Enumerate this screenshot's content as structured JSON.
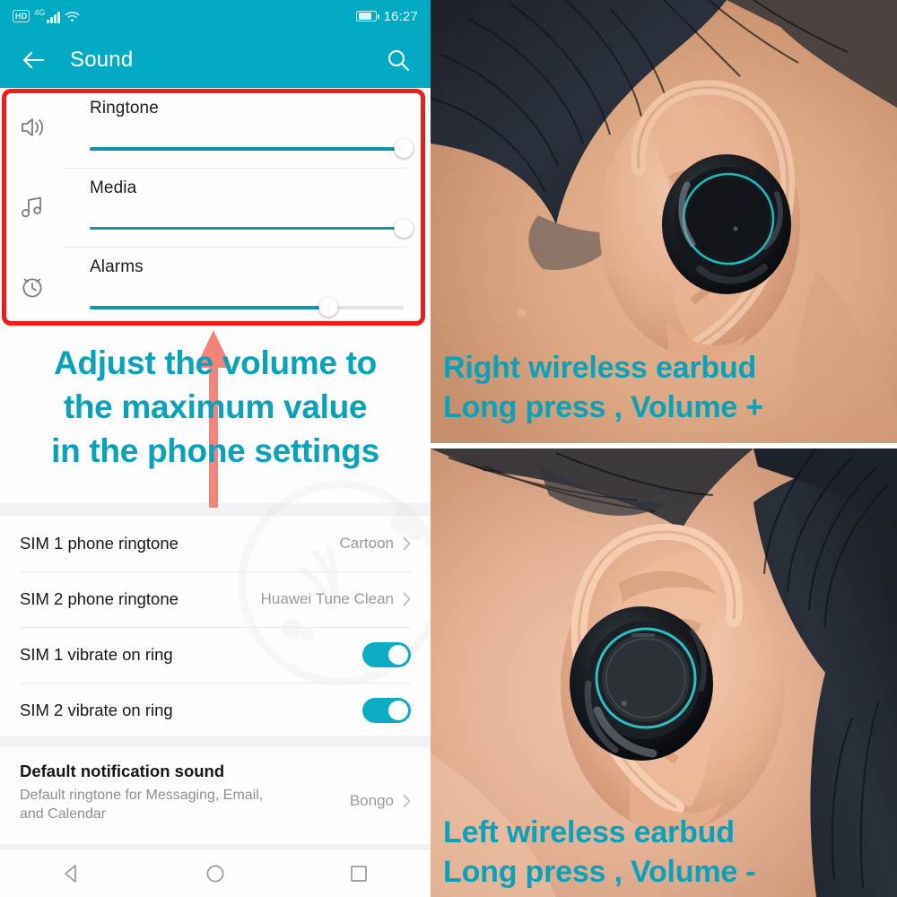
{
  "phone": {
    "statusbar": {
      "hd_badge": "HD",
      "network_label": "4G",
      "signal_icon": "signal-bars-icon",
      "wifi_icon": "wifi-icon",
      "battery_icon": "battery-icon",
      "clock": "16:27"
    },
    "actionbar": {
      "back_icon": "back-arrow-icon",
      "title": "Sound",
      "search_icon": "search-icon"
    },
    "volume_sliders": [
      {
        "icon": "speaker-volume-icon",
        "label": "Ringtone",
        "value": 100
      },
      {
        "icon": "music-note-icon",
        "label": "Media",
        "value": 100
      },
      {
        "icon": "alarm-clock-icon",
        "label": "Alarms",
        "value": 76
      }
    ],
    "caption": "Adjust the volume to the maximum value in the phone settings",
    "caption_lines": [
      "Adjust the volume to",
      "the maximum value",
      "in the phone settings"
    ],
    "arrow_icon": "up-arrow-annotation",
    "settings_rows": [
      {
        "label": "SIM 1 phone ringtone",
        "value": "Cartoon",
        "control": "chevron"
      },
      {
        "label": "SIM 2 phone ringtone",
        "value": "Huawei Tune Clean",
        "control": "chevron"
      },
      {
        "label": "SIM 1 vibrate on ring",
        "value": "",
        "control": "toggle",
        "toggle_on": true
      },
      {
        "label": "SIM 2 vibrate on ring",
        "value": "",
        "control": "toggle",
        "toggle_on": true
      }
    ],
    "notification": {
      "title": "Default notification sound",
      "subtitle": "Default ringtone for Messaging, Email, and Calendar",
      "value": "Bongo"
    },
    "navbar": [
      {
        "icon": "back-triangle-icon",
        "label": "Back"
      },
      {
        "icon": "home-circle-icon",
        "label": "Home"
      },
      {
        "icon": "recents-square-icon",
        "label": "Recents"
      }
    ]
  },
  "photos": [
    {
      "name": "right-earbud-photo",
      "caption_lines": [
        "Right wireless earbud",
        "Long press , Volume +"
      ],
      "caption": "Right wireless earbud Long press , Volume +"
    },
    {
      "name": "left-earbud-photo",
      "caption_lines": [
        "Left wireless earbud",
        "Long press , Volume -"
      ],
      "caption": "Left wireless earbud Long press , Volume -"
    }
  ],
  "colors": {
    "header_teal": "#03aac3",
    "caption_teal": "#09a2bb",
    "slider_fill": "#1494ab",
    "toggle_on": "#0cadc4",
    "highlight_box_red": "#ee1c1c",
    "arrow_salmon": "#f4847b"
  }
}
